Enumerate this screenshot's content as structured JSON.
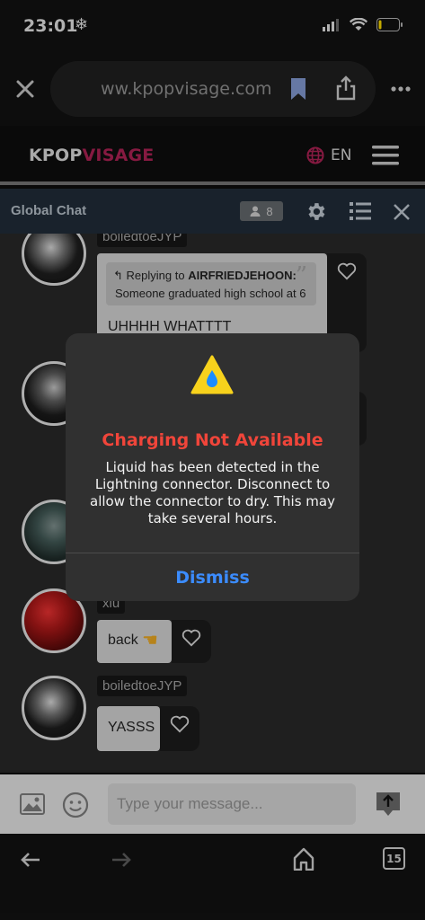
{
  "status_bar": {
    "time": "23:01"
  },
  "browser": {
    "url": "ww.kpopvisage.com",
    "tab_count": "15"
  },
  "site": {
    "logo_part1": "KPOP",
    "logo_part2": "VISAGE",
    "language": "EN"
  },
  "chat": {
    "title": "Global Chat",
    "online_count": "8",
    "input_placeholder": "Type your message..."
  },
  "messages": [
    {
      "user": "boiledtoeJYP",
      "reply_label": "Replying to ",
      "reply_to": "AIRFRIEDJEHOON:",
      "reply_text": "Someone graduated high school at 6",
      "text": "UHHHH WHATTTT"
    },
    {
      "user": "xiu",
      "text": "back"
    },
    {
      "user": "boiledtoeJYP",
      "text": "YASSS"
    }
  ],
  "alert": {
    "title": "Charging Not Available",
    "message": "Liquid has been detected in the Lightning connector. Disconnect to allow the connector to dry. This may take several hours.",
    "dismiss_label": "Dismiss"
  },
  "colors": {
    "alert_title": "#f0453a",
    "dismiss": "#3b8cff",
    "logo_accent": "#a42050",
    "chat_header": "#1f2a36"
  }
}
